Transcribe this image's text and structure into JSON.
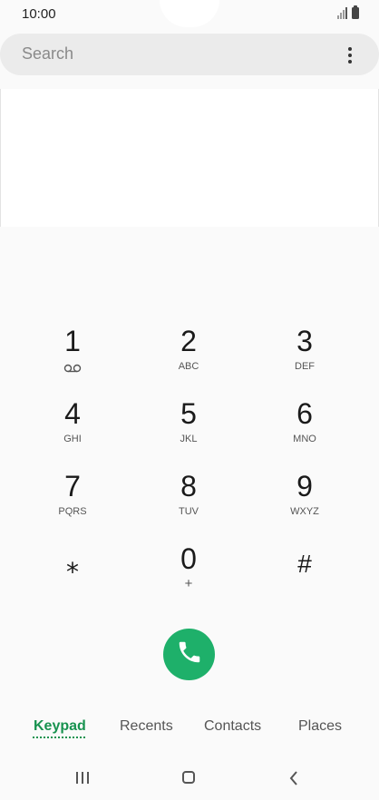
{
  "status_bar": {
    "time": "10:00",
    "icons": [
      "signal-icon",
      "battery-icon"
    ]
  },
  "search": {
    "placeholder": "Search",
    "menu_icon": "more-vertical-icon"
  },
  "keypad": {
    "keys": [
      {
        "digit": "1",
        "sub": "",
        "icon": "voicemail-icon"
      },
      {
        "digit": "2",
        "sub": "ABC"
      },
      {
        "digit": "3",
        "sub": "DEF"
      },
      {
        "digit": "4",
        "sub": "GHI"
      },
      {
        "digit": "5",
        "sub": "JKL"
      },
      {
        "digit": "6",
        "sub": "MNO"
      },
      {
        "digit": "7",
        "sub": "PQRS"
      },
      {
        "digit": "8",
        "sub": "TUV"
      },
      {
        "digit": "9",
        "sub": "WXYZ"
      },
      {
        "digit": "⁎",
        "sub": ""
      },
      {
        "digit": "0",
        "sub": "+"
      },
      {
        "digit": "#",
        "sub": ""
      }
    ]
  },
  "call_button": {
    "icon": "phone-icon",
    "color": "#1eb06a"
  },
  "tabs": {
    "items": [
      "Keypad",
      "Recents",
      "Contacts",
      "Places"
    ],
    "active": "Keypad",
    "active_color": "#17924f"
  },
  "nav_bar": {
    "icons": [
      "recents-nav-icon",
      "home-nav-icon",
      "back-nav-icon"
    ]
  }
}
